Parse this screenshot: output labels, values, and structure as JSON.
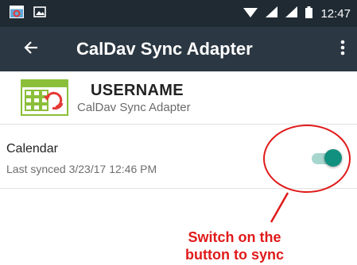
{
  "status_bar": {
    "time": "12:47",
    "icons": [
      "photo-icon",
      "image-icon",
      "wifi-icon",
      "signal-icon",
      "signal-icon",
      "battery-icon"
    ]
  },
  "app_bar": {
    "title": "CalDav Sync Adapter",
    "back_icon": "back-arrow-icon",
    "menu_icon": "more-vert-icon"
  },
  "account": {
    "username": "USERNAME",
    "subtitle": "CalDav Sync Adapter",
    "icon": "calendar-sync-icon"
  },
  "sync_item": {
    "title": "Calendar",
    "subtitle": "Last synced 3/23/17 12:46 PM",
    "switch_on": true
  },
  "annotation": {
    "line1": "Switch on the",
    "line2": "button to sync"
  },
  "colors": {
    "status_bar": "#1f2a33",
    "app_bar": "#2b3742",
    "switch_thumb": "#12907f",
    "switch_track": "#a7d6cf",
    "annotation": "#e01a1a"
  }
}
